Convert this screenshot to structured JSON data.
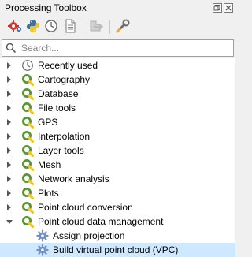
{
  "panel": {
    "title": "Processing Toolbox"
  },
  "search": {
    "placeholder": "Search..."
  },
  "tree": {
    "items": [
      {
        "label": "Recently used",
        "icon": "history-icon",
        "expanded": false
      },
      {
        "label": "Cartography",
        "icon": "qgis-logo-icon",
        "expanded": false
      },
      {
        "label": "Database",
        "icon": "qgis-logo-icon",
        "expanded": false
      },
      {
        "label": "File tools",
        "icon": "qgis-logo-icon",
        "expanded": false
      },
      {
        "label": "GPS",
        "icon": "qgis-logo-icon",
        "expanded": false
      },
      {
        "label": "Interpolation",
        "icon": "qgis-logo-icon",
        "expanded": false
      },
      {
        "label": "Layer tools",
        "icon": "qgis-logo-icon",
        "expanded": false
      },
      {
        "label": "Mesh",
        "icon": "qgis-logo-icon",
        "expanded": false
      },
      {
        "label": "Network analysis",
        "icon": "qgis-logo-icon",
        "expanded": false
      },
      {
        "label": "Plots",
        "icon": "qgis-logo-icon",
        "expanded": false
      },
      {
        "label": "Point cloud conversion",
        "icon": "qgis-logo-icon",
        "expanded": false
      },
      {
        "label": "Point cloud data management",
        "icon": "qgis-logo-icon",
        "expanded": true
      },
      {
        "label": "Assign projection",
        "icon": "algorithm-gear-icon",
        "child": true
      },
      {
        "label": "Build virtual point cloud (VPC)",
        "icon": "algorithm-gear-icon",
        "child": true,
        "selected": true
      }
    ]
  },
  "colors": {
    "selection": "#cde8ff",
    "qgis_green": "#589632",
    "gear_blue": "#6f8fc4"
  }
}
